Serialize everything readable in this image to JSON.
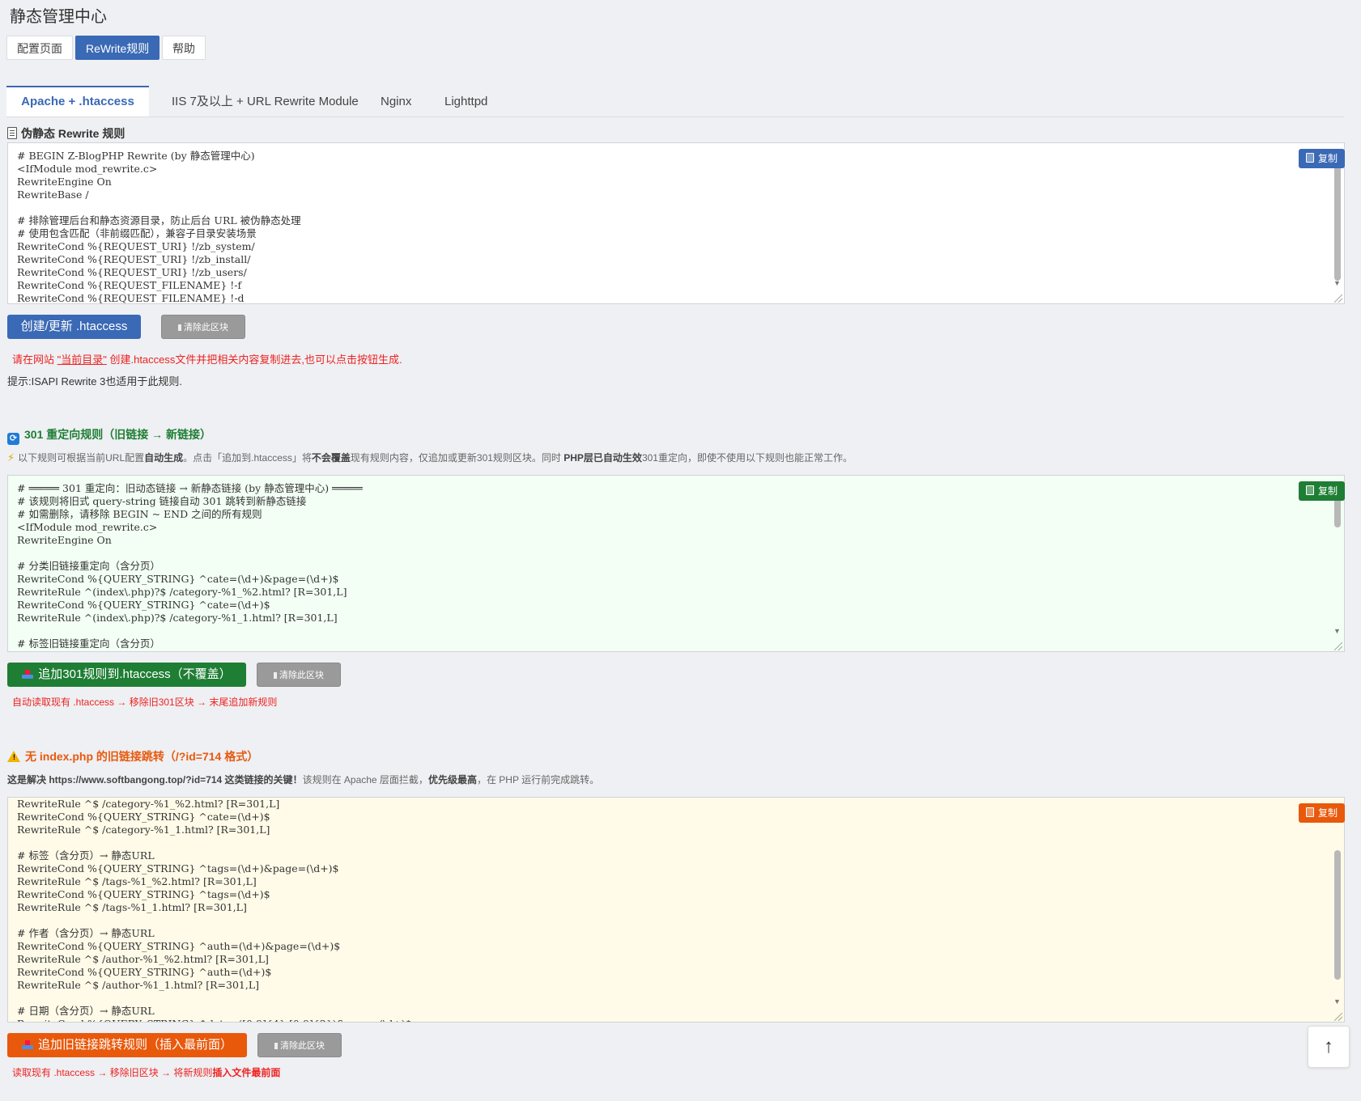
{
  "page": {
    "title": "静态管理中心"
  },
  "topnav": {
    "items": [
      "配置页面",
      "ReWrite规则",
      "帮助"
    ],
    "active": "ReWrite规则"
  },
  "tabs": {
    "items": [
      "Apache + .htaccess",
      "IIS 7及以上 + URL Rewrite Module",
      "Nginx",
      "Lighttpd"
    ],
    "active": "Apache + .htaccess"
  },
  "colors": {
    "blue": "#3a69b5",
    "green": "#1e7e34",
    "orange": "#e8590c",
    "red": "#e22222"
  },
  "section1": {
    "icon": "clipboard-icon",
    "heading": "伪静态 Rewrite 规则",
    "copy_label": "复制",
    "code": "# BEGIN Z-BlogPHP Rewrite (by 静态管理中心)\n<IfModule mod_rewrite.c>\nRewriteEngine On\nRewriteBase /\n\n# 排除管理后台和静态资源目录，防止后台 URL 被伪静态处理\n# 使用包含匹配（非前缀匹配），兼容子目录安装场景\nRewriteCond %{REQUEST_URI} !/zb_system/\nRewriteCond %{REQUEST_URI} !/zb_install/\nRewriteCond %{REQUEST_URI} !/zb_users/\nRewriteCond %{REQUEST_FILENAME} !-f\nRewriteCond %{REQUEST_FILENAME} !-d",
    "primary_button": "创建/更新 .htaccess",
    "clear_button": "清除此区块",
    "tip_prefix": "请在网站 ",
    "tip_link": "\"当前目录\"",
    "tip_suffix": " 创建.htaccess文件并把相关内容复制进去,也可以点击按钮生成.",
    "note": "提示:ISAPI Rewrite 3也适用于此规则."
  },
  "section2": {
    "icon": "refresh-icon",
    "heading": "301 重定向规则（旧链接 → 新链接）",
    "desc_1": "以下规则可根据当前URL配置",
    "desc_b1": "自动生成",
    "desc_2": "。点击「追加到.htaccess」将",
    "desc_b2": "不会覆盖",
    "desc_3": "现有规则内容，仅追加或更新301规则区块。同时 ",
    "desc_b3": "PHP层已自动生效",
    "desc_4": "301重定向，即使不使用以下规则也能正常工作。",
    "copy_label": "复制",
    "code": "# ═════ 301 重定向：旧动态链接 → 新静态链接 (by 静态管理中心) ═════\n# 该规则将旧式 query-string 链接自动 301 跳转到新静态链接\n# 如需删除，请移除 BEGIN ~ END 之间的所有规则\n<IfModule mod_rewrite.c>\nRewriteEngine On\n\n# 分类旧链接重定向（含分页）\nRewriteCond %{QUERY_STRING} ^cate=(\\d+)&page=(\\d+)$\nRewriteRule ^(index\\.php)?$ /category-%1_%2.html? [R=301,L]\nRewriteCond %{QUERY_STRING} ^cate=(\\d+)$\nRewriteRule ^(index\\.php)?$ /category-%1_1.html? [R=301,L]\n\n# 标签旧链接重定向（含分页）",
    "primary_button": "追加301规则到.htaccess（不覆盖）",
    "clear_button": "清除此区块",
    "tip": "自动读取现有 .htaccess → 移除旧301区块 → 末尾追加新规则"
  },
  "section3": {
    "icon": "warning-icon",
    "heading": "无 index.php 的旧链接跳转（/?id=714 格式）",
    "desc_b1": "这是解决 https://www.softbangong.top/?id=714 这类链接的关键！",
    "desc_1": "该规则在 Apache 层面拦截，",
    "desc_b2": "优先级最高",
    "desc_2": "，在 PHP 运行前完成跳转。",
    "copy_label": "复制",
    "code": "RewriteRule ^$ /category-%1_%2.html? [R=301,L]\nRewriteCond %{QUERY_STRING} ^cate=(\\d+)$\nRewriteRule ^$ /category-%1_1.html? [R=301,L]\n\n# 标签（含分页）→ 静态URL\nRewriteCond %{QUERY_STRING} ^tags=(\\d+)&page=(\\d+)$\nRewriteRule ^$ /tags-%1_%2.html? [R=301,L]\nRewriteCond %{QUERY_STRING} ^tags=(\\d+)$\nRewriteRule ^$ /tags-%1_1.html? [R=301,L]\n\n# 作者（含分页）→ 静态URL\nRewriteCond %{QUERY_STRING} ^auth=(\\d+)&page=(\\d+)$\nRewriteRule ^$ /author-%1_%2.html? [R=301,L]\nRewriteCond %{QUERY_STRING} ^auth=(\\d+)$\nRewriteRule ^$ /author-%1_1.html? [R=301,L]\n\n# 日期（含分页）→ 静态URL\nRewriteCond %{QUERY_STRING} ^date=([0-9]{4}-[0-9]{2})&page=(\\d+)$",
    "primary_button": "追加旧链接跳转规则（插入最前面）",
    "clear_button": "清除此区块",
    "tip_1": "读取现有 .htaccess → 移除旧区块 → 将新规则",
    "tip_b": "插入文件最前面"
  },
  "back_to_top": {
    "icon": "arrow-up-icon"
  }
}
